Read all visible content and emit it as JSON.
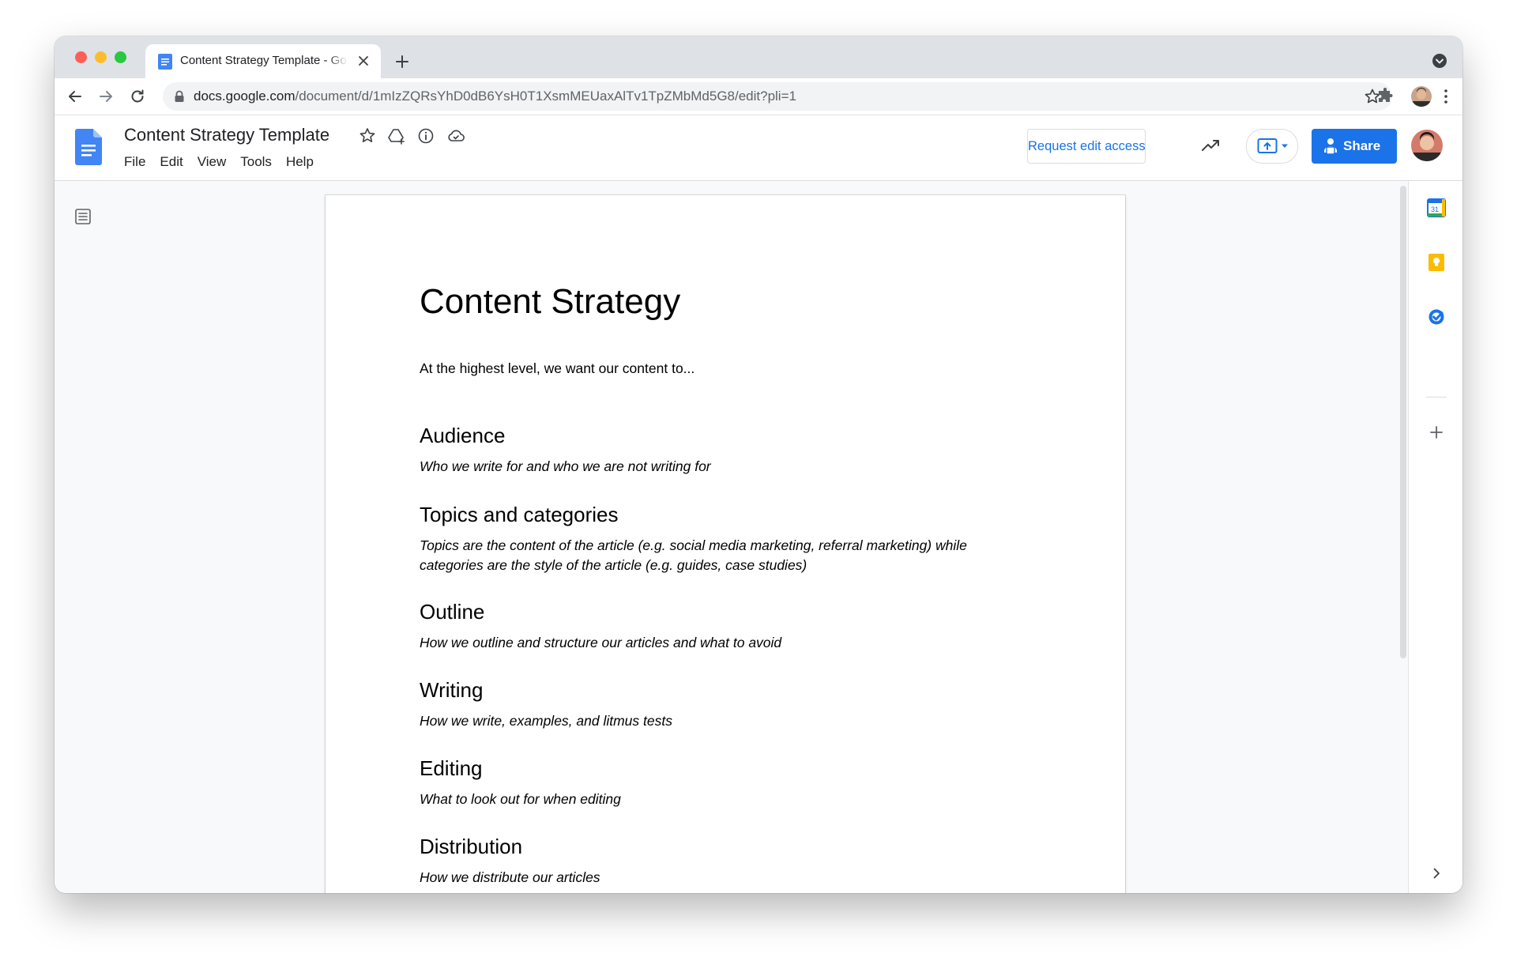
{
  "browser": {
    "tab": {
      "title": "Content Strategy Template - Google Docs"
    },
    "url": {
      "host": "docs.google.com",
      "path": "/document/d/1mIzZQRsYhD0dB6YsH0T1XsmMEUaxAlTv1TpZMbMd5G8/edit?pli=1"
    }
  },
  "header": {
    "doc_title": "Content Strategy Template",
    "menu": [
      "File",
      "Edit",
      "View",
      "Tools",
      "Help"
    ],
    "request_edit_label": "Request edit access",
    "share_label": "Share"
  },
  "document": {
    "title": "Content Strategy",
    "intro": "At the highest level, we want our content to...",
    "sections": [
      {
        "heading": "Audience",
        "body": "Who we write for and who we are not writing for"
      },
      {
        "heading": "Topics and categories",
        "body": "Topics are the content of the article (e.g. social media marketing, referral marketing) while categories are the style of the article (e.g. guides, case studies)"
      },
      {
        "heading": "Outline",
        "body": "How we outline and structure our articles and what to avoid"
      },
      {
        "heading": "Writing",
        "body": "How we write, examples, and litmus tests"
      },
      {
        "heading": "Editing",
        "body": "What to look out for when editing"
      },
      {
        "heading": "Distribution",
        "body": "How we distribute our articles"
      }
    ]
  },
  "side_panel": {
    "calendar_day": "31",
    "icons": [
      "calendar-icon",
      "keep-icon",
      "tasks-icon",
      "add-icon",
      "chevron-right-icon"
    ]
  },
  "colors": {
    "accent": "#1a73e8",
    "docs_blue": "#4285f4",
    "keep_yellow": "#fbbc04"
  }
}
